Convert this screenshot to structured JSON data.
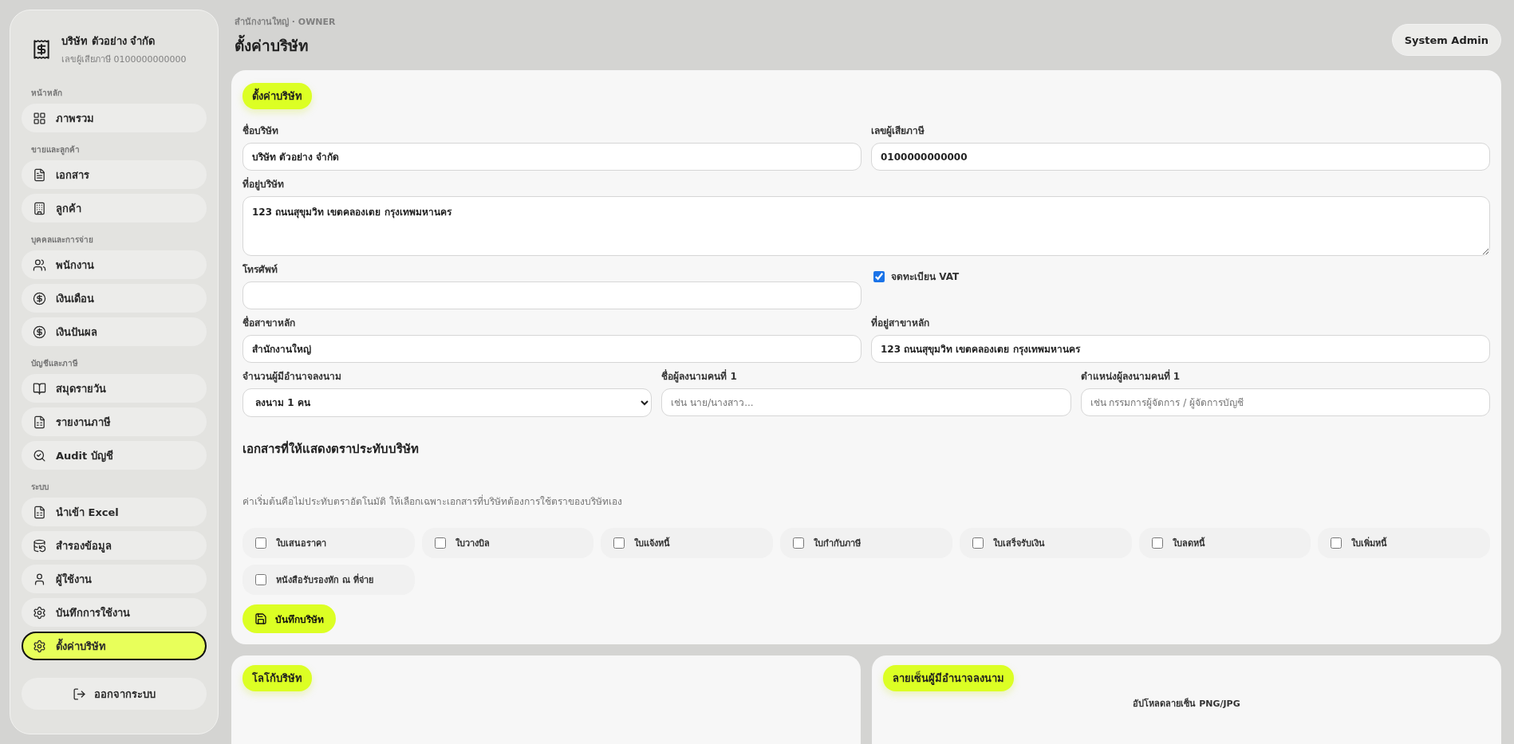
{
  "sidebar": {
    "company_name": "บริษัท ตัวอย่าง จำกัด",
    "tax_id": "เลขผู้เสียภาษี 0100000000000",
    "sections": [
      {
        "title": "หน้าหลัก",
        "items": [
          {
            "label": "ภาพรวม",
            "selected": false
          }
        ]
      },
      {
        "title": "ขายและลูกค้า",
        "items": [
          {
            "label": "เอกสาร",
            "selected": false
          },
          {
            "label": "ลูกค้า",
            "selected": false
          }
        ]
      },
      {
        "title": "บุคคลและการจ่าย",
        "items": [
          {
            "label": "พนักงาน",
            "selected": false
          },
          {
            "label": "เงินเดือน",
            "selected": false
          },
          {
            "label": "เงินปันผล",
            "selected": false
          }
        ]
      },
      {
        "title": "บัญชีและภาษี",
        "items": [
          {
            "label": "สมุดรายวัน",
            "selected": false
          },
          {
            "label": "รายงานภาษี",
            "selected": false
          },
          {
            "label": "Audit บัญชี",
            "selected": false
          }
        ]
      },
      {
        "title": "ระบบ",
        "items": [
          {
            "label": "นำเข้า Excel",
            "selected": false
          },
          {
            "label": "สำรองข้อมูล",
            "selected": false
          },
          {
            "label": "ผู้ใช้งาน",
            "selected": false
          },
          {
            "label": "บันทึกการใช้งาน",
            "selected": false
          },
          {
            "label": "ตั้งค่าบริษัท",
            "selected": true
          }
        ]
      }
    ],
    "logout": "ออกจากระบบ"
  },
  "header": {
    "breadcrumb": "สำนักงานใหญ่ · OWNER",
    "title": "ตั้งค่าบริษัท",
    "user_button": "System Admin"
  },
  "company_form": {
    "badge": "ตั้งค่าบริษัท",
    "company_name": {
      "label": "ชื่อบริษัท",
      "value": "บริษัท ตัวอย่าง จำกัด"
    },
    "tax_id": {
      "label": "เลขผู้เสียภาษี",
      "value": "0100000000000"
    },
    "address": {
      "label": "ที่อยู่บริษัท",
      "value": "123 ถนนสุขุมวิท เขตคลองเตย กรุงเทพมหานคร"
    },
    "phone": {
      "label": "โทรศัพท์"
    },
    "vat_registered": {
      "label": "จดทะเบียน VAT",
      "checked": true
    },
    "branch_name": {
      "label": "ชื่อสาขาหลัก",
      "value": "สำนักงานใหญ่"
    },
    "branch_address": {
      "label": "ที่อยู่สาขาหลัก",
      "value": "123 ถนนสุขุมวิท เขตคลองเตย กรุงเทพมหานคร"
    },
    "signer_count": {
      "label": "จำนวนผู้มีอำนาจลงนาม",
      "value": "ลงนาม 1 คน"
    },
    "signer_name": {
      "label": "ชื่อผู้ลงนามคนที่ 1",
      "placeholder": "เช่น นาย/นางสาว..."
    },
    "signer_position": {
      "label": "ตำแหน่งผู้ลงนามคนที่ 1",
      "placeholder": "เช่น กรรมการผู้จัดการ / ผู้จัดการบัญชี"
    },
    "stamp_title": "เอกสารที่ให้แสดงตราประทับบริษัท",
    "stamp_hint": "ค่าเริ่มต้นคือไม่ประทับตราอัตโนมัติ ให้เลือกเฉพาะเอกสารที่บริษัทต้องการใช้ตราของบริษัทเอง",
    "stamp_documents": [
      {
        "label": "ใบเสนอราคา",
        "checked": false
      },
      {
        "label": "ใบวางบิล",
        "checked": false
      },
      {
        "label": "ใบแจ้งหนี้",
        "checked": false
      },
      {
        "label": "ใบกำกับภาษี",
        "checked": false
      },
      {
        "label": "ใบเสร็จรับเงิน",
        "checked": false
      },
      {
        "label": "ใบลดหนี้",
        "checked": false
      },
      {
        "label": "ใบเพิ่มหนี้",
        "checked": false
      },
      {
        "label": "หนังสือรับรองหัก ณ ที่จ่าย",
        "checked": false
      }
    ],
    "save_button": "บันทึกบริษัท"
  },
  "logo_card": {
    "badge": "โลโก้บริษัท"
  },
  "signature_card": {
    "badge": "ลายเซ็นผู้มีอำนาจลงนาม",
    "upload_hint": "อัปโหลดลายเซ็น PNG/JPG"
  }
}
